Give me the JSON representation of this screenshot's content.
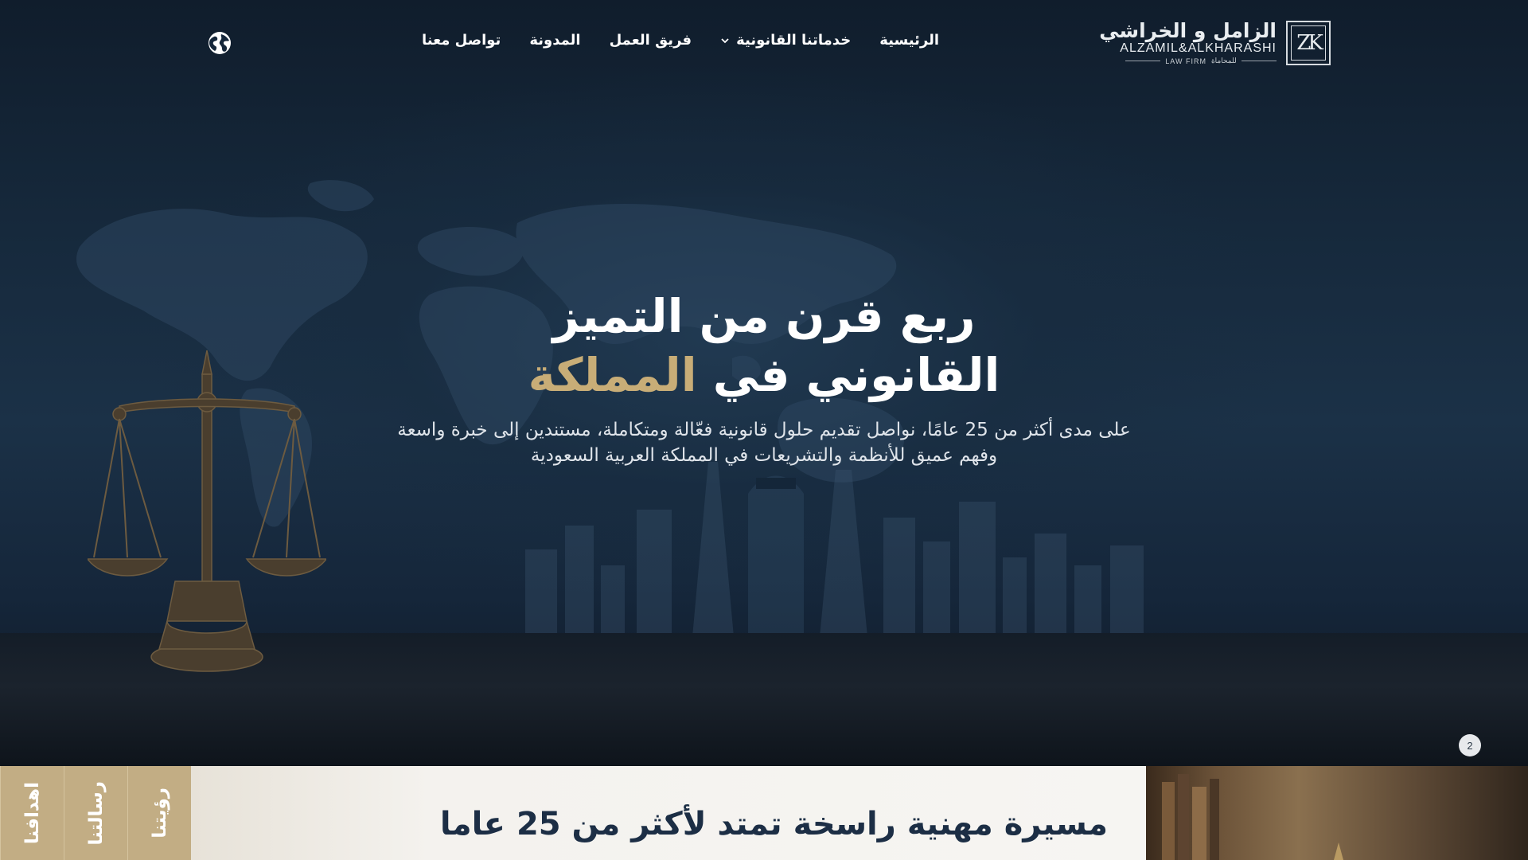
{
  "brand": {
    "name_ar": "الزامل و الخراشي",
    "name_en": "ALZAMIL&ALKHARASHI",
    "sub_en": "LAW FIRM",
    "sub_ar": "للمحاماة",
    "monogram": "ZK"
  },
  "nav": {
    "items": [
      {
        "label": "الرئيسية"
      },
      {
        "label": "خدماتنا القانونية",
        "has_dropdown": true
      },
      {
        "label": "فريق العمل"
      },
      {
        "label": "المدونة"
      },
      {
        "label": "تواصل معنا"
      }
    ],
    "language_icon": "globe-icon"
  },
  "hero": {
    "title_line1": "ربع قرن من التميز",
    "title_line2_white": "القانوني في",
    "title_line2_gold": "المملكة",
    "description_line1": "على مدى أكثر من 25 عامًا، نواصل تقديم حلول قانونية فعّالة ومتكاملة، مستندين إلى خبرة واسعة",
    "description_line2": "وفهم عميق للأنظمة والتشريعات في المملكة العربية السعودية",
    "slide_indicator": "2"
  },
  "about_tabs": [
    {
      "label": "رؤيتنا"
    },
    {
      "label": "رسالتنا"
    },
    {
      "label": "اهدافنا"
    }
  ],
  "about_section": {
    "title": "مسيرة مهنية راسخة تمتد لأكثر من 25 عاما"
  },
  "colors": {
    "background": "#15263a",
    "gold_accent": "#c8ad77",
    "tab_gold": "#c2ad84",
    "heading_navy": "#1c2e45"
  }
}
